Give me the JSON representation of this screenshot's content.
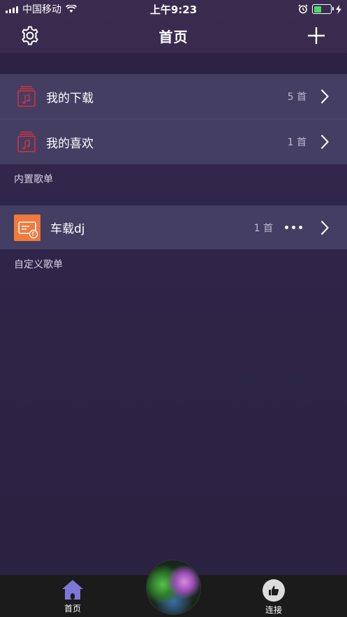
{
  "status_bar": {
    "carrier": "中国移动",
    "time": "上午9:23",
    "battery_level": 0.45,
    "battery_color": "#4cd964"
  },
  "nav": {
    "title": "首页",
    "left_icon": "gear-icon",
    "right_icon": "plus-icon"
  },
  "builtin_playlists": {
    "items": [
      {
        "label": "我的下载",
        "count": "5 首",
        "icon": "music-note-icon"
      },
      {
        "label": "我的喜欢",
        "count": "1 首",
        "icon": "music-note-icon"
      }
    ],
    "section_label": "内置歌单"
  },
  "custom_playlists": {
    "items": [
      {
        "label": "车载dj",
        "count": "1 首",
        "icon": "playlist-cover-icon"
      }
    ],
    "section_label": "自定义歌单"
  },
  "tab_bar": {
    "home_label": "首页",
    "connect_label": "连接"
  },
  "colors": {
    "accent_red": "#d4323a",
    "cover_orange": "#f07a3c",
    "home_tab_active": "#7f76d9"
  }
}
